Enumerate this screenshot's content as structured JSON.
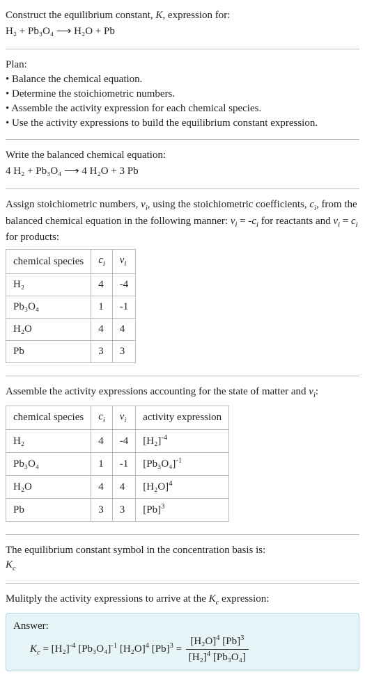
{
  "intro": {
    "construct_text": "Construct the equilibrium constant, K, expression for:",
    "reaction": "H₂ + Pb₃O₄ ⟶ H₂O + Pb"
  },
  "plan": {
    "heading": "Plan:",
    "items": [
      "Balance the chemical equation.",
      "Determine the stoichiometric numbers.",
      "Assemble the activity expression for each chemical species.",
      "Use the activity expressions to build the equilibrium constant expression."
    ]
  },
  "balanced": {
    "heading": "Write the balanced chemical equation:",
    "equation": "4 H₂ + Pb₃O₄ ⟶ 4 H₂O + 3 Pb"
  },
  "stoich": {
    "heading_pre": "Assign stoichiometric numbers, ",
    "heading_mid1": ", using the stoichiometric coefficients, ",
    "heading_mid2": ", from the balanced chemical equation in the following manner: ",
    "heading_rel1": " for reactants and ",
    "heading_rel2": " for products:",
    "col_species": "chemical species",
    "rows": [
      {
        "sp": "H₂",
        "c": "4",
        "v": "-4"
      },
      {
        "sp": "Pb₃O₄",
        "c": "1",
        "v": "-1"
      },
      {
        "sp": "H₂O",
        "c": "4",
        "v": "4"
      },
      {
        "sp": "Pb",
        "c": "3",
        "v": "3"
      }
    ]
  },
  "activity": {
    "heading_pre": "Assemble the activity expressions accounting for the state of matter and ",
    "heading_post": ":",
    "col_species": "chemical species",
    "col_activity": "activity expression",
    "rows": [
      {
        "sp": "H₂",
        "c": "4",
        "v": "-4",
        "expr_base": "[H₂]",
        "expr_pow": "-4"
      },
      {
        "sp": "Pb₃O₄",
        "c": "1",
        "v": "-1",
        "expr_base": "[Pb₃O₄]",
        "expr_pow": "-1"
      },
      {
        "sp": "H₂O",
        "c": "4",
        "v": "4",
        "expr_base": "[H₂O]",
        "expr_pow": "4"
      },
      {
        "sp": "Pb",
        "c": "3",
        "v": "3",
        "expr_base": "[Pb]",
        "expr_pow": "3"
      }
    ]
  },
  "symbol": {
    "line1": "The equilibrium constant symbol in the concentration basis is:",
    "kc": "K",
    "kc_sub": "c"
  },
  "final": {
    "heading_pre": "Mulitply the activity expressions to arrive at the ",
    "heading_post": " expression:",
    "answer_label": "Answer:",
    "kc": "K",
    "kc_sub": "c",
    "terms": {
      "t1_base": "[H₂]",
      "t1_pow": "-4",
      "t2_base": "[Pb₃O₄]",
      "t2_pow": "-1",
      "t3_base": "[H₂O]",
      "t3_pow": "4",
      "t4_base": "[Pb]",
      "t4_pow": "3",
      "num1_base": "[H₂O]",
      "num1_pow": "4",
      "num2_base": "[Pb]",
      "num2_pow": "3",
      "den1_base": "[H₂]",
      "den1_pow": "4",
      "den2_base": "[Pb₃O₄]"
    }
  }
}
